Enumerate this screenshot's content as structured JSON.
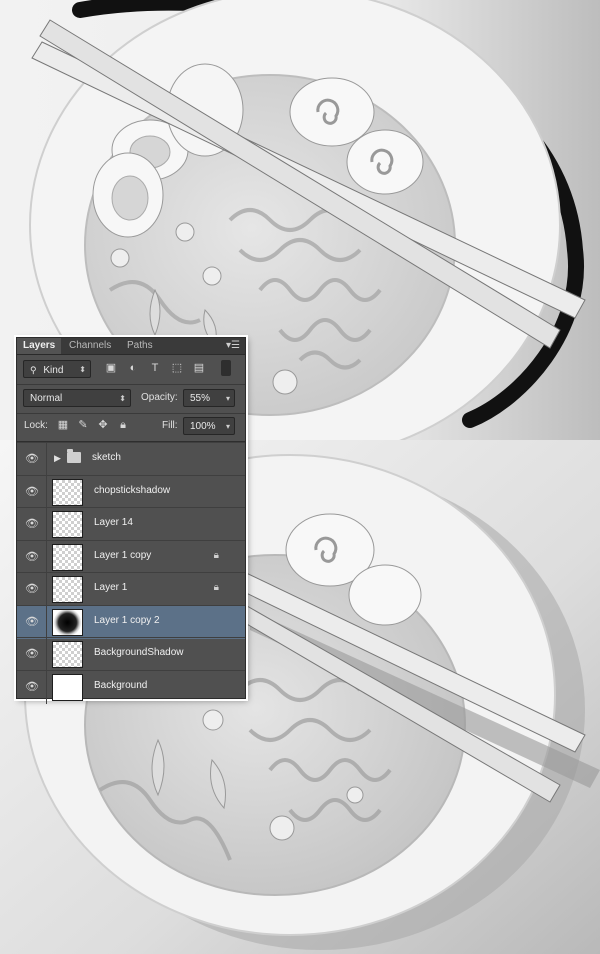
{
  "panel": {
    "tabs": [
      "Layers",
      "Channels",
      "Paths"
    ],
    "menu_icon": "panel-menu-icon",
    "filter_kind": "Kind",
    "blend_mode": "Normal",
    "opacity_label": "Opacity:",
    "opacity_value": "55%",
    "lock_label": "Lock:",
    "fill_label": "Fill:",
    "fill_value": "100%",
    "layers": [
      {
        "name": "sketch",
        "type": "group",
        "locked": false,
        "selected": false
      },
      {
        "name": "chopstickshadow",
        "type": "layer",
        "locked": false,
        "selected": false
      },
      {
        "name": "Layer 14",
        "type": "layer",
        "locked": false,
        "selected": false
      },
      {
        "name": "Layer 1 copy",
        "type": "layer",
        "locked": true,
        "selected": false
      },
      {
        "name": "Layer 1",
        "type": "layer",
        "locked": true,
        "selected": false
      },
      {
        "name": "Layer 1 copy 2",
        "type": "layer",
        "locked": false,
        "selected": true
      },
      {
        "name": "BackgroundShadow",
        "type": "layer",
        "locked": false,
        "selected": false
      },
      {
        "name": "Background",
        "type": "layer",
        "locked": false,
        "selected": false
      }
    ],
    "selected_color": "#5c7188"
  },
  "artwork": {
    "subject": "ramen bowl with chopsticks illustration (grayscale)"
  }
}
